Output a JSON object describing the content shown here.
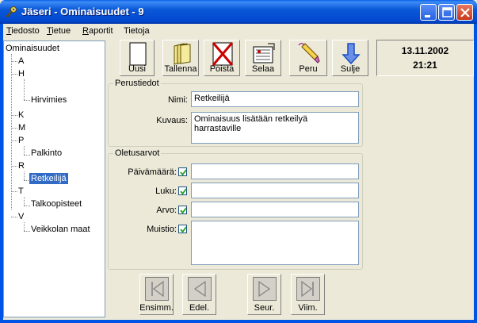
{
  "window": {
    "title": "Jäseri - Ominaisuudet - 9"
  },
  "menu": [
    {
      "label": "Tiedosto",
      "accel": "T",
      "rest": "iedosto"
    },
    {
      "label": "Tietue",
      "accel": "T",
      "rest": "ietue"
    },
    {
      "label": "Raportit",
      "accel": "R",
      "rest": "aportit"
    },
    {
      "label": "Tietoja",
      "accel": "",
      "rest": "Tietoja"
    }
  ],
  "tree": {
    "root": "Ominaisuudet",
    "items": [
      {
        "label": "A",
        "level": 1
      },
      {
        "label": "H",
        "level": 1
      },
      {
        "label": "Hirvimies",
        "level": 2
      },
      {
        "label": "K",
        "level": 1
      },
      {
        "label": "M",
        "level": 1
      },
      {
        "label": "P",
        "level": 1
      },
      {
        "label": "Palkinto",
        "level": 2
      },
      {
        "label": "R",
        "level": 1
      },
      {
        "label": "Retkeilijä",
        "level": 2,
        "selected": true
      },
      {
        "label": "T",
        "level": 1
      },
      {
        "label": "Talkoopisteet",
        "level": 2
      },
      {
        "label": "V",
        "level": 1
      },
      {
        "label": "Veikkolan maat",
        "level": 2
      }
    ]
  },
  "toolbar": {
    "buttons": [
      {
        "label": "Uusi",
        "icon": "new-document-icon"
      },
      {
        "label": "Tallenna",
        "icon": "save-folder-icon"
      },
      {
        "label": "Poista",
        "icon": "delete-x-icon"
      },
      {
        "label": "Selaa",
        "icon": "browse-list-icon"
      },
      {
        "label": "Peru",
        "icon": "undo-eraser-icon"
      },
      {
        "label": "Sulje",
        "icon": "close-arrow-down-icon"
      }
    ]
  },
  "datetime": {
    "date": "13.11.2002",
    "time": "21:21"
  },
  "perustiedot": {
    "legend": "Perustiedot",
    "nimi_label": "Nimi:",
    "nimi_value": "Retkeilijä",
    "kuvaus_label": "Kuvaus:",
    "kuvaus_value": "Ominaisuus lisätään retkeilyä harrastaville"
  },
  "oletusarvot": {
    "legend": "Oletusarvot",
    "fields": [
      {
        "label": "Päivämäärä:",
        "checked": true,
        "value": ""
      },
      {
        "label": "Luku:",
        "checked": true,
        "value": ""
      },
      {
        "label": "Arvo:",
        "checked": true,
        "value": ""
      },
      {
        "label": "Muistio:",
        "checked": true,
        "value": ""
      }
    ]
  },
  "navigation": [
    {
      "label": "Ensimm.",
      "icon": "first-record-icon"
    },
    {
      "label": "Edel.",
      "icon": "previous-record-icon"
    },
    {
      "label": "Seur.",
      "icon": "next-record-icon"
    },
    {
      "label": "Viim.",
      "icon": "last-record-icon"
    }
  ],
  "colors": {
    "titlebar": "#0054e3",
    "selection": "#316ac5",
    "face": "#ece9d8",
    "delete_red": "#cc0000",
    "close_arrow_blue": "#1a4fc4"
  }
}
